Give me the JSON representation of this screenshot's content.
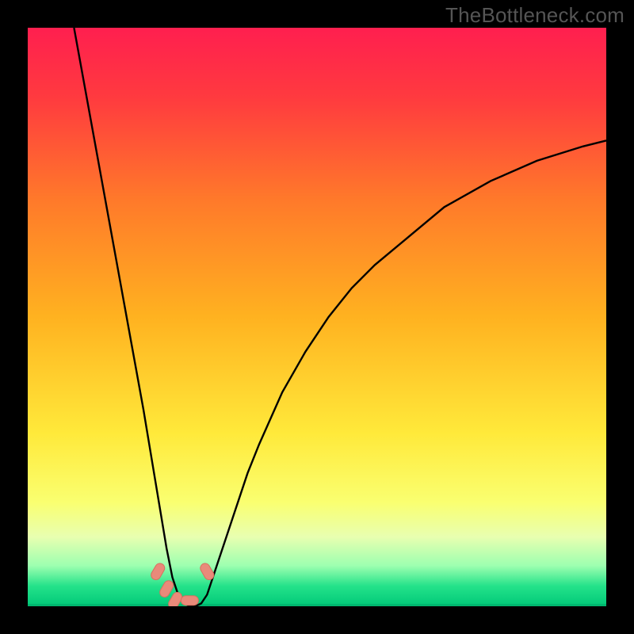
{
  "attribution": "TheBottleneck.com",
  "colors": {
    "frame": "#000000",
    "curve": "#000000",
    "marker_fill": "#e98a7a",
    "marker_stroke": "#d6705e",
    "gradient_stops": [
      {
        "offset": 0.0,
        "color": "#ff1f4f"
      },
      {
        "offset": 0.12,
        "color": "#ff3a3f"
      },
      {
        "offset": 0.3,
        "color": "#ff7a2a"
      },
      {
        "offset": 0.5,
        "color": "#ffb220"
      },
      {
        "offset": 0.7,
        "color": "#ffe93a"
      },
      {
        "offset": 0.82,
        "color": "#faff70"
      },
      {
        "offset": 0.88,
        "color": "#e8ffb0"
      },
      {
        "offset": 0.93,
        "color": "#9dffb0"
      },
      {
        "offset": 0.965,
        "color": "#24e28a"
      },
      {
        "offset": 1.0,
        "color": "#00c878"
      }
    ]
  },
  "chart_data": {
    "type": "line",
    "title": "",
    "xlabel": "",
    "ylabel": "",
    "xlim": [
      0,
      100
    ],
    "ylim": [
      0,
      100
    ],
    "x": [
      8,
      10,
      12,
      14,
      16,
      18,
      20,
      22,
      23,
      24,
      25,
      26,
      27,
      28,
      29,
      30,
      31,
      32,
      34,
      36,
      38,
      40,
      44,
      48,
      52,
      56,
      60,
      66,
      72,
      80,
      88,
      96,
      100
    ],
    "values": [
      100,
      89,
      78,
      67,
      56,
      45,
      34,
      22,
      16,
      10,
      5,
      2,
      0.5,
      0,
      0,
      0.5,
      2,
      5,
      11,
      17,
      23,
      28,
      37,
      44,
      50,
      55,
      59,
      64,
      69,
      73.5,
      77,
      79.5,
      80.5
    ],
    "markers_x": [
      22.5,
      24.0,
      25.5,
      28.0,
      31.0
    ],
    "markers_y": [
      6.0,
      3.0,
      1.0,
      1.0,
      6.0
    ]
  }
}
